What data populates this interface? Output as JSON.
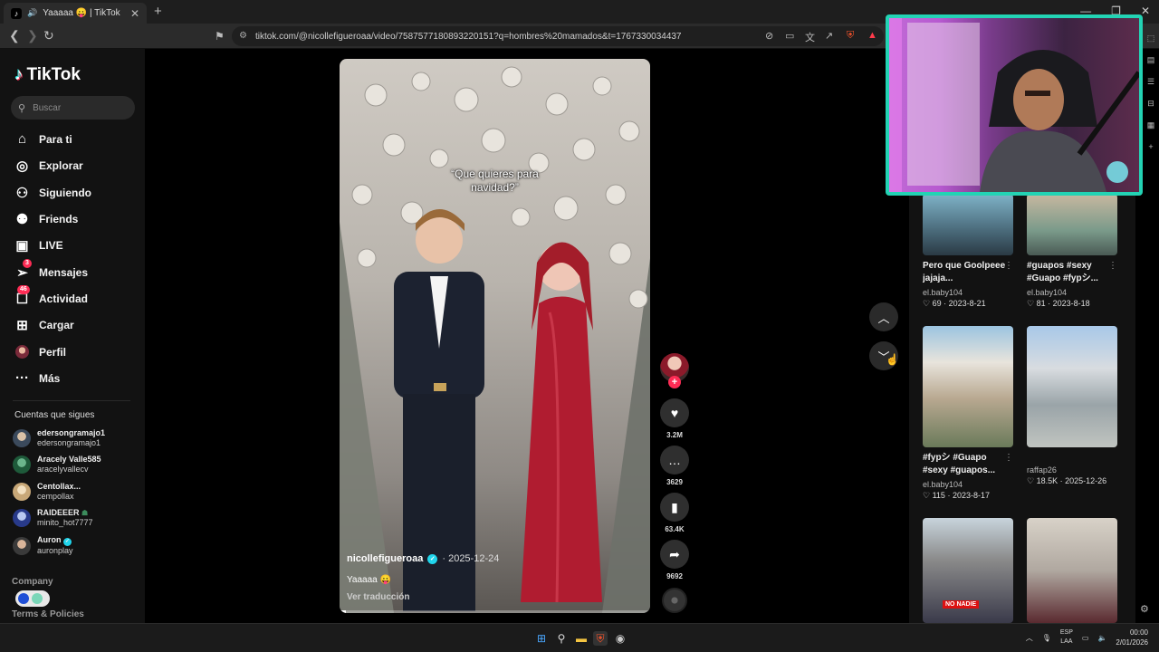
{
  "browser": {
    "tab_title": "Yaaaaa 😛 | TikTok",
    "url": "tiktok.com/@nicollefigueroaa/video/7587577180893220151?q=hombres%20mamados&t=1767330034437"
  },
  "sidebar": {
    "logo": "TikTok",
    "search_placeholder": "Buscar",
    "nav": [
      {
        "label": "Para ti",
        "icon": "home-icon"
      },
      {
        "label": "Explorar",
        "icon": "compass-icon"
      },
      {
        "label": "Siguiendo",
        "icon": "following-icon"
      },
      {
        "label": "Friends",
        "icon": "friends-icon"
      },
      {
        "label": "LIVE",
        "icon": "live-icon"
      },
      {
        "label": "Mensajes",
        "icon": "messages-icon",
        "badge": "3"
      },
      {
        "label": "Actividad",
        "icon": "activity-icon",
        "badge": "46"
      },
      {
        "label": "Cargar",
        "icon": "upload-icon"
      },
      {
        "label": "Perfil",
        "icon": "profile-icon"
      },
      {
        "label": "Más",
        "icon": "more-icon"
      }
    ],
    "following_title": "Cuentas que sigues",
    "following": [
      {
        "name": "edersongramajo1",
        "handle": "edersongramajo1"
      },
      {
        "name": "Aracely Valle585",
        "handle": "aracelyvallecv"
      },
      {
        "name": "Centollax...",
        "handle": "cempollax"
      },
      {
        "name": "RAIDEEER",
        "handle": "minito_hot7777"
      },
      {
        "name": "Auron",
        "handle": "auronplay"
      }
    ],
    "company": "Company",
    "terms": "Terms & Policies"
  },
  "video": {
    "overlay_text_line1": "“Que quieres para",
    "overlay_text_line2": "navidad?”",
    "author": "nicollefigueroaa",
    "date": "· 2025-12-24",
    "description": "Yaaaaa 😛",
    "translate": "Ver traducción",
    "progress": 0.02
  },
  "actions": {
    "likes": "3.2M",
    "comments": "3629",
    "saves": "63.4K",
    "shares": "9692"
  },
  "right_panel": {
    "cards": [
      {
        "title": "Pero que Goolpeee jajaja...",
        "author": "el.baby104",
        "likes": "69",
        "date": "2023-8-21"
      },
      {
        "title": "#guapos #sexy #Guapo #fypシ...",
        "author": "el.baby104",
        "likes": "81",
        "date": "2023-8-18"
      },
      {
        "title": "#fypシ #Guapo #sexy #guapos...",
        "author": "el.baby104",
        "likes": "115",
        "date": "2023-8-17"
      },
      {
        "title": "",
        "author": "raffap26",
        "likes": "18.5K",
        "date": "2025-12-26"
      },
      {
        "title": "",
        "author": "",
        "likes": "",
        "date": ""
      },
      {
        "title": "",
        "author": "",
        "likes": "",
        "date": ""
      }
    ],
    "thumb_overlay_text": "NO NADIE"
  },
  "taskbar": {
    "lang_line1": "ESP",
    "lang_line2": "LAA",
    "time": "00:00",
    "date": "2/01/2026"
  }
}
